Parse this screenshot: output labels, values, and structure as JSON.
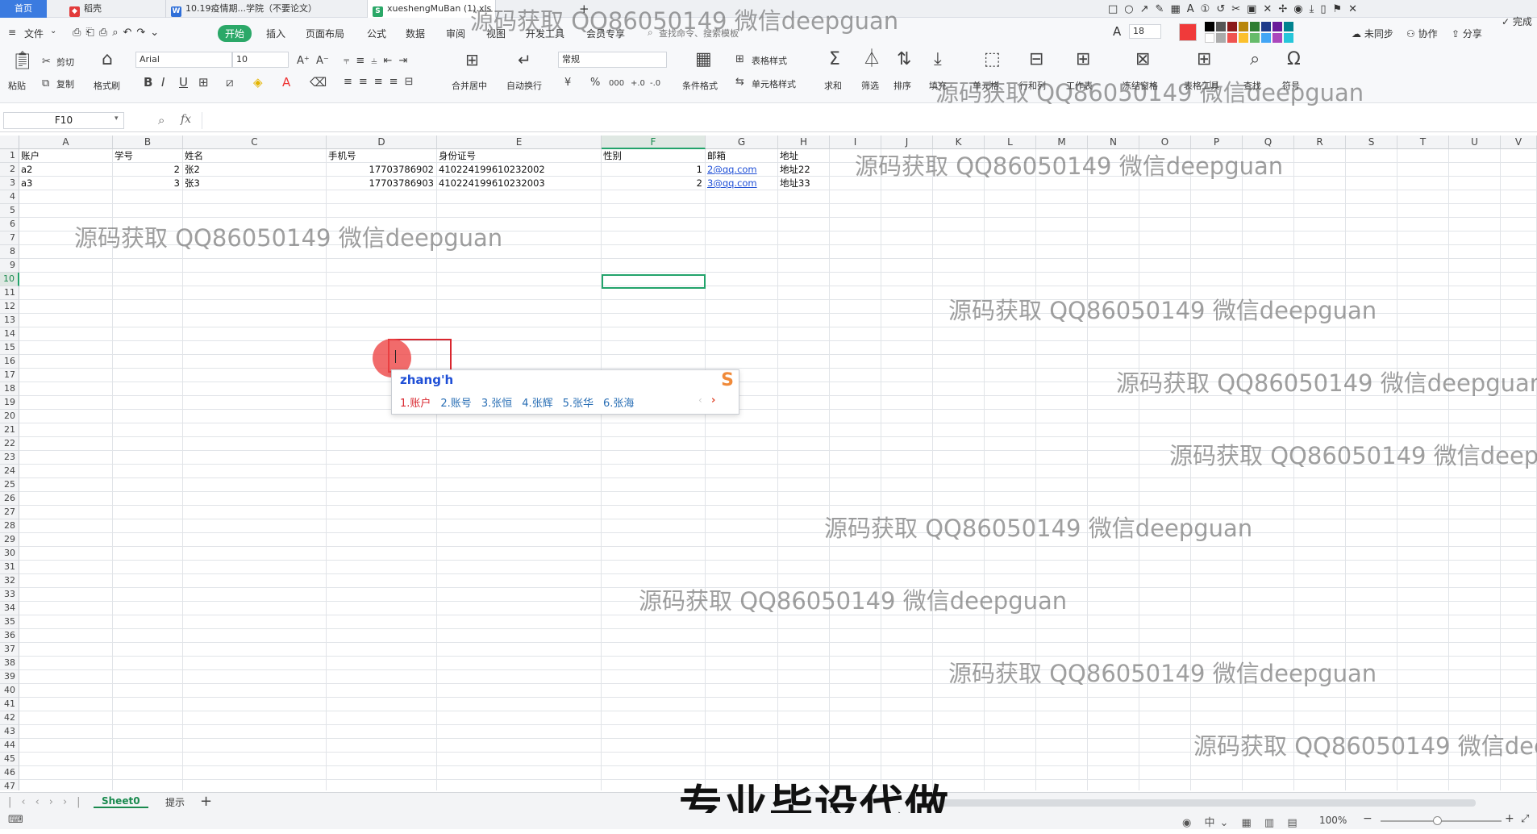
{
  "tabs": {
    "home": "首页",
    "t1": "稻壳",
    "t2": "10.19疫情期...学院（不要论文）",
    "t3": "xueshengMuBan (1).xls"
  },
  "menu": {
    "file": "文件",
    "start": "开始",
    "insert": "插入",
    "layout": "页面布局",
    "formula": "公式",
    "data": "数据",
    "review": "审阅",
    "view": "视图",
    "dev": "开发工具",
    "member": "会员专享",
    "search": "查找命令、搜索模板",
    "sync": "未同步",
    "collab": "协作",
    "share": "分享",
    "done": "完成"
  },
  "annot": {
    "size": "18",
    "color": "#f03a3a"
  },
  "ribbon": {
    "paste": "粘贴",
    "cut": "剪切",
    "copy": "复制",
    "format_painter": "格式刷",
    "font": "Arial",
    "font_size": "10",
    "merge": "合并居中",
    "wrap": "自动换行",
    "number_format": "常规",
    "table_style": "表格样式",
    "cond_format": "条件格式",
    "cell_style": "单元格样式",
    "sum": "求和",
    "filter": "筛选",
    "sort": "排序",
    "fill": "填充",
    "cell": "单元格",
    "rowcol": "行和列",
    "sheet": "工作表",
    "freeze": "冻结窗格",
    "table_tools": "表格工具",
    "find": "查找",
    "symbol": "符号",
    "currency": "¥",
    "percent": "%",
    "thousands": "000",
    "inc_dec": "+.0",
    "dec_dec": "-.0"
  },
  "formula_bar": {
    "name_box": "F10",
    "fx": "fx",
    "value": ""
  },
  "columns": [
    "A",
    "B",
    "C",
    "D",
    "E",
    "F",
    "G",
    "H",
    "I",
    "J",
    "K",
    "L",
    "M",
    "N",
    "O",
    "P",
    "Q",
    "R",
    "S",
    "T",
    "U",
    "V"
  ],
  "rows": [
    [
      "账户",
      "学号",
      "姓名",
      "手机号",
      "身份证号",
      "性别",
      "邮箱",
      "地址"
    ],
    [
      "a2",
      "2",
      "张2",
      "17703786902",
      "410224199610232002",
      "1",
      "2@qq.com",
      "地址22"
    ],
    [
      "a3",
      "3",
      "张3",
      "17703786903",
      "410224199610232003",
      "2",
      "3@qq.com",
      "地址33"
    ]
  ],
  "ime": {
    "input": "zhang'h",
    "candidates": [
      "1.账户",
      "2.账号",
      "3.张恒",
      "4.张辉",
      "5.张华",
      "6.张海"
    ]
  },
  "watermark": "源码获取 QQ86050149 微信deepguan",
  "sheet_tabs": [
    "Sheet0",
    "提示"
  ],
  "caption": "专业毕设代做",
  "status": {
    "zoom": "100%"
  }
}
